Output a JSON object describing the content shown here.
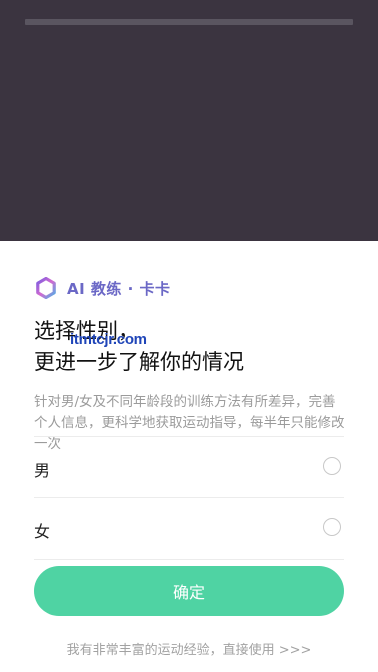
{
  "coach": {
    "name": "AI 教练 · 卡卡",
    "logo_icon": "coach-ring-logo"
  },
  "page": {
    "title_line1": "选择性别，",
    "title_line2": "更进一步了解你的情况",
    "description": "针对男/女及不同年龄段的训练方法有所差异，完善个人信息，更科学地获取运动指导，每半年只能修改一次",
    "watermark": "itmtcjr.com"
  },
  "options": [
    {
      "label": "男",
      "selected": false
    },
    {
      "label": "女",
      "selected": false
    }
  ],
  "confirm_label": "确定",
  "skip_label": "我有非常丰富的运动经验，直接使用 >>>",
  "colors": {
    "backdrop": "#3b3440",
    "accent_green": "#4fd3a3",
    "coach_purple": "#6b68c6"
  }
}
